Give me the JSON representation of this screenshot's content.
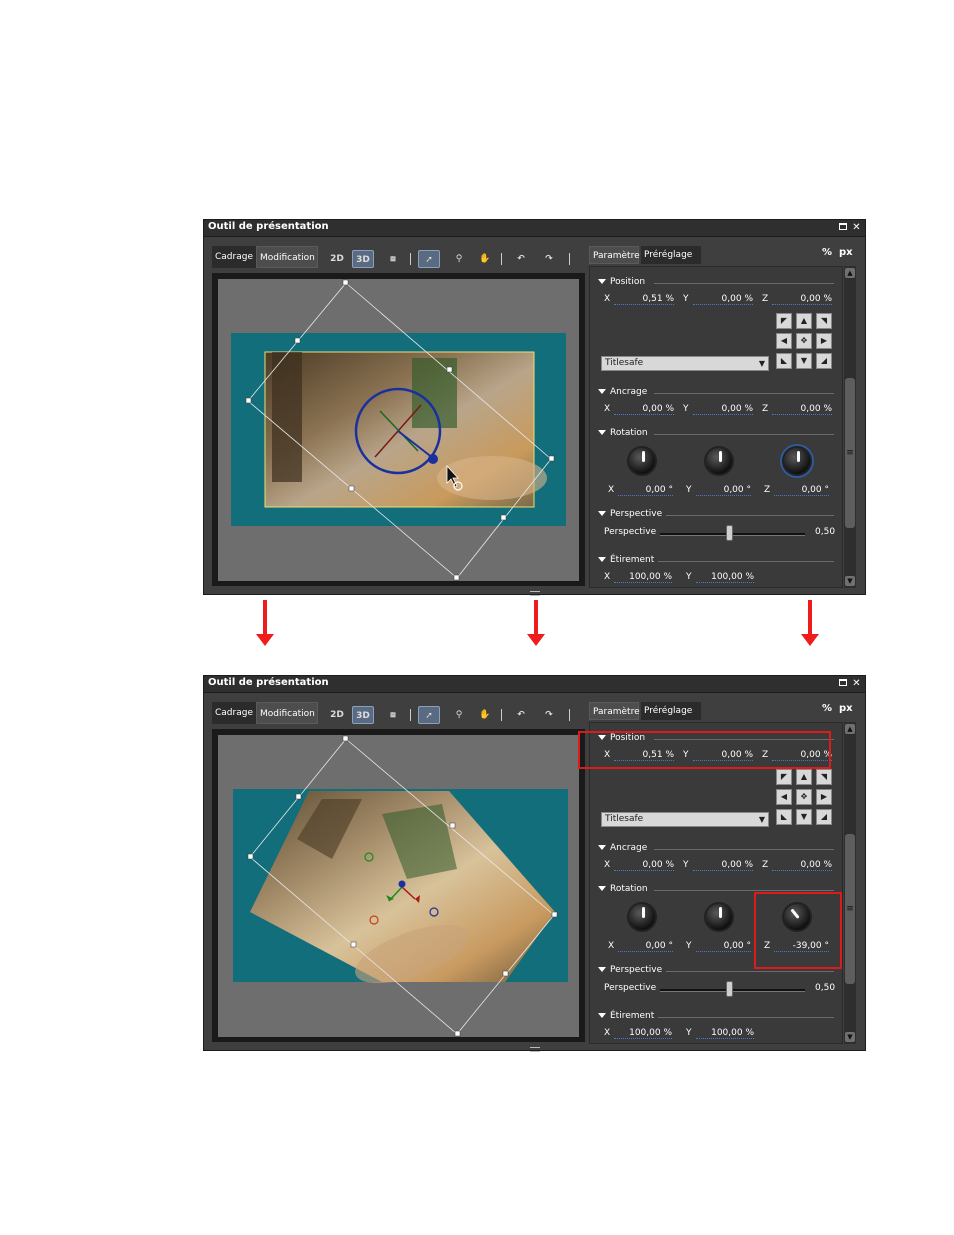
{
  "windows": [
    {
      "title": "Outil de présentation",
      "tabs": {
        "cadrage": "Cadrage",
        "modification": "Modification"
      },
      "toolbar": {
        "btn_2d": "2D",
        "btn_3d": "3D"
      },
      "right_tabs": {
        "parametre": "Paramètre",
        "preréglage": "Préréglage"
      },
      "units": {
        "percent": "%",
        "px": "px"
      },
      "position": {
        "label": "Position",
        "x_label": "X",
        "x": "0,51 %",
        "y_label": "Y",
        "y": "0,00 %",
        "z_label": "Z",
        "z": "0,00 %"
      },
      "titlesafe": "Titlesafe",
      "ancrage": {
        "label": "Ancrage",
        "x_label": "X",
        "x": "0,00 %",
        "y_label": "Y",
        "y": "0,00 %",
        "z_label": "Z",
        "z": "0,00 %"
      },
      "rotation": {
        "label": "Rotation",
        "x_label": "X",
        "x": "0,00 °",
        "y_label": "Y",
        "y": "0,00 °",
        "z_label": "Z",
        "z": "0,00 °"
      },
      "perspective": {
        "label": "Perspective",
        "slider_label": "Perspective",
        "value": "0,50"
      },
      "etirement": {
        "label": "Étirement",
        "x_label": "X",
        "x": "100,00 %",
        "y_label": "Y",
        "y": "100,00 %"
      }
    },
    {
      "title": "Outil de présentation",
      "tabs": {
        "cadrage": "Cadrage",
        "modification": "Modification"
      },
      "toolbar": {
        "btn_2d": "2D",
        "btn_3d": "3D"
      },
      "right_tabs": {
        "parametre": "Paramètre",
        "preréglage": "Préréglage"
      },
      "units": {
        "percent": "%",
        "px": "px"
      },
      "position": {
        "label": "Position",
        "x_label": "X",
        "x": "0,51 %",
        "y_label": "Y",
        "y": "0,00 %",
        "z_label": "Z",
        "z": "0,00 %"
      },
      "titlesafe": "Titlesafe",
      "ancrage": {
        "label": "Ancrage",
        "x_label": "X",
        "x": "0,00 %",
        "y_label": "Y",
        "y": "0,00 %",
        "z_label": "Z",
        "z": "0,00 %"
      },
      "rotation": {
        "label": "Rotation",
        "x_label": "X",
        "x": "0,00 °",
        "y_label": "Y",
        "y": "0,00 °",
        "z_label": "Z",
        "z": "-39,00 °"
      },
      "perspective": {
        "label": "Perspective",
        "slider_label": "Perspective",
        "value": "0,50"
      },
      "etirement": {
        "label": "Étirement",
        "x_label": "X",
        "x": "100,00 %",
        "y_label": "Y",
        "y": "100,00 %"
      }
    }
  ],
  "colors": {
    "arrow": "#ee1c1c",
    "highlight": "#dd1b1b",
    "canvas_frame": "#136e7c"
  }
}
